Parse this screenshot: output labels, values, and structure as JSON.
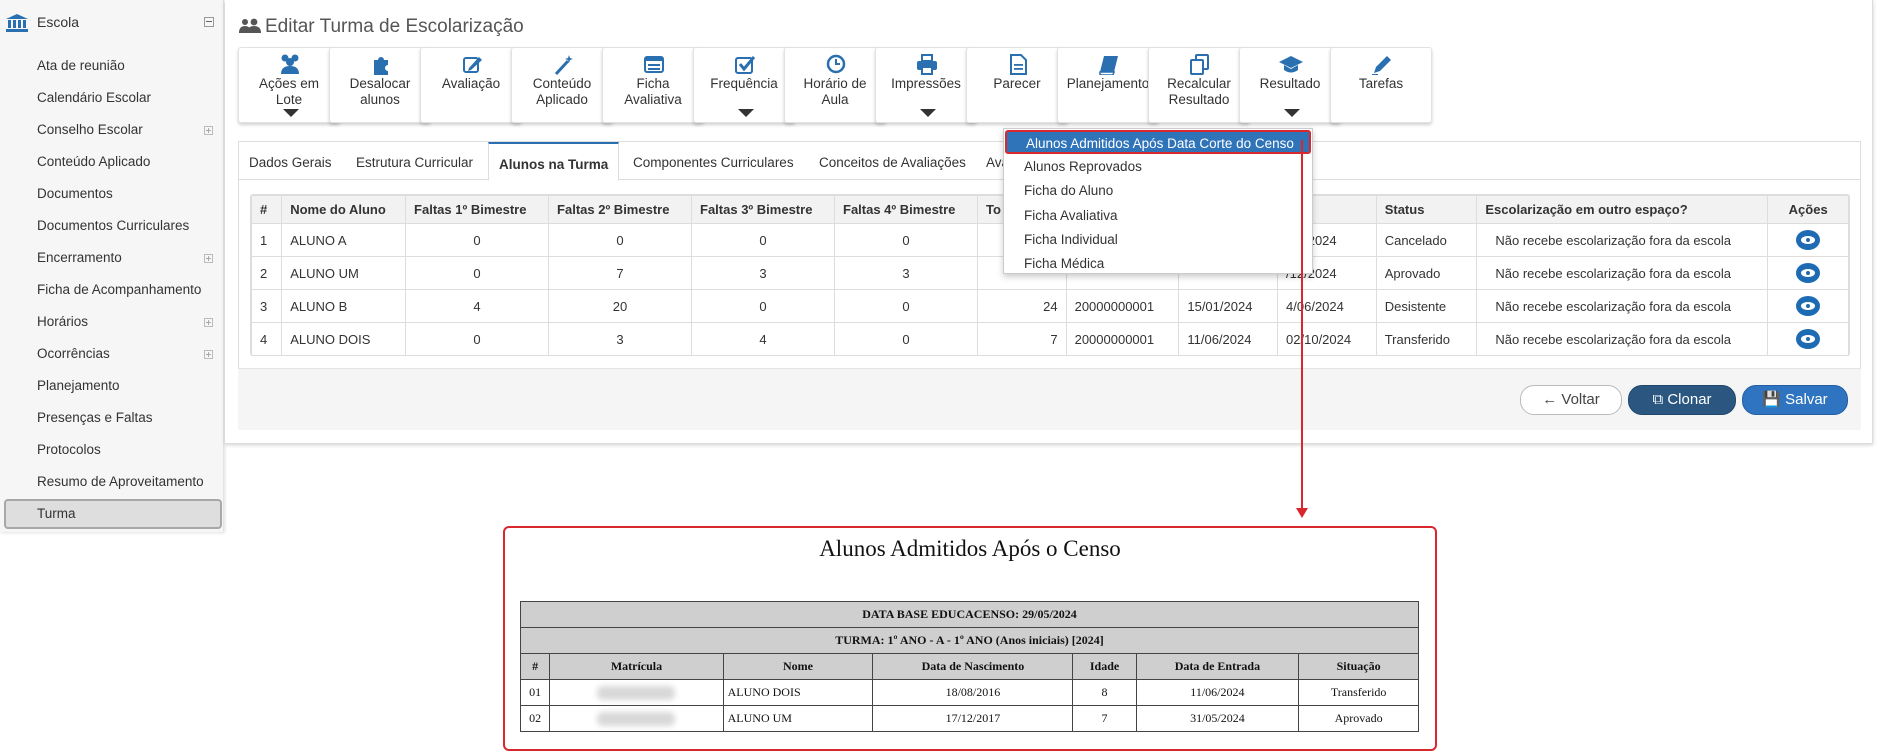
{
  "sidebar": {
    "title": "Escola",
    "items": [
      {
        "label": "Ata de reunião",
        "expandable": false
      },
      {
        "label": "Calendário Escolar",
        "expandable": false
      },
      {
        "label": "Conselho Escolar",
        "expandable": true
      },
      {
        "label": "Conteúdo Aplicado",
        "expandable": false
      },
      {
        "label": "Documentos",
        "expandable": false
      },
      {
        "label": "Documentos Curriculares",
        "expandable": false
      },
      {
        "label": "Encerramento",
        "expandable": true
      },
      {
        "label": "Ficha de Acompanhamento",
        "expandable": false
      },
      {
        "label": "Horários",
        "expandable": true
      },
      {
        "label": "Ocorrências",
        "expandable": true
      },
      {
        "label": "Planejamento",
        "expandable": false
      },
      {
        "label": "Presenças e Faltas",
        "expandable": false
      },
      {
        "label": "Protocolos",
        "expandable": false
      },
      {
        "label": "Resumo de Aproveitamento",
        "expandable": false
      },
      {
        "label": "Turma",
        "expandable": false,
        "active": true
      }
    ]
  },
  "page": {
    "title": "Editar Turma de Escolarização"
  },
  "toolbar": [
    {
      "l1": "Ações em",
      "l2": "Lote",
      "icon": "users-icon",
      "caret": true
    },
    {
      "l1": "Desalocar",
      "l2": "alunos",
      "icon": "puzzle-icon",
      "caret": false
    },
    {
      "l1": "Avaliação",
      "l2": "",
      "icon": "edit-icon",
      "caret": false
    },
    {
      "l1": "Conteúdo",
      "l2": "Aplicado",
      "icon": "magic-wand-icon",
      "caret": false
    },
    {
      "l1": "Ficha",
      "l2": "Avaliativa",
      "icon": "list-icon",
      "caret": false
    },
    {
      "l1": "Frequência",
      "l2": "",
      "icon": "check-icon",
      "caret": true
    },
    {
      "l1": "Horário de",
      "l2": "Aula",
      "icon": "clock-icon",
      "caret": false
    },
    {
      "l1": "Impressões",
      "l2": "",
      "icon": "print-icon",
      "caret": true
    },
    {
      "l1": "Parecer",
      "l2": "",
      "icon": "document-icon",
      "caret": false
    },
    {
      "l1": "Planejamento",
      "l2": "",
      "icon": "book-icon",
      "caret": false
    },
    {
      "l1": "Recalcular",
      "l2": "Resultado",
      "icon": "copy-icon",
      "caret": false
    },
    {
      "l1": "Resultado",
      "l2": "",
      "icon": "graduation-cap-icon",
      "caret": true
    },
    {
      "l1": "Tarefas",
      "l2": "",
      "icon": "pencil-icon",
      "caret": false
    }
  ],
  "tabs": [
    "Dados Gerais",
    "Estrutura Curricular",
    "Alunos na Turma",
    "Componentes Curriculares",
    "Conceitos de Avaliações",
    "Ava"
  ],
  "students_table": {
    "headers": [
      "#",
      "Nome do Aluno",
      "Faltas 1º Bimestre",
      "Faltas 2º Bimestre",
      "Faltas 3º Bimestre",
      "Faltas 4º Bimestre",
      "To",
      "",
      "",
      "ída",
      "Status",
      "Escolarização em outro espaço?",
      "Ações"
    ],
    "rows": [
      [
        "1",
        "ALUNO A",
        "0",
        "0",
        "0",
        "0",
        "",
        "",
        "",
        "/01/2024",
        "Cancelado",
        "Não recebe escolarização fora da escola"
      ],
      [
        "2",
        "ALUNO UM",
        "0",
        "7",
        "3",
        "3",
        "",
        "",
        "",
        "/12/2024",
        "Aprovado",
        "Não recebe escolarização fora da escola"
      ],
      [
        "3",
        "ALUNO B",
        "4",
        "20",
        "0",
        "0",
        "24",
        "20000000001",
        "15/01/2024",
        "4/06/2024",
        "Desistente",
        "Não recebe escolarização fora da escola"
      ],
      [
        "4",
        "ALUNO DOIS",
        "0",
        "3",
        "4",
        "0",
        "7",
        "20000000001",
        "11/06/2024",
        "02/10/2024",
        "Transferido",
        "Não recebe escolarização fora da escola"
      ]
    ]
  },
  "buttons": {
    "voltar": "Voltar",
    "clonar": "Clonar",
    "salvar": "Salvar"
  },
  "dropdown": {
    "items": [
      "Alunos Admitidos Após Data Corte do Censo",
      "Alunos Reprovados",
      "Ficha do Aluno",
      "Ficha Avaliativa",
      "Ficha Individual",
      "Ficha Médica"
    ]
  },
  "report": {
    "title": "Alunos Admitidos Após o Censo",
    "base_line": "DATA BASE EDUCACENSO: 29/05/2024",
    "turma_line": "TURMA: 1º ANO - A - 1º ANO (Anos iniciais) [2024]",
    "headers": [
      "#",
      "Matrícula",
      "Nome",
      "Data de Nascimento",
      "Idade",
      "Data de Entrada",
      "Situação"
    ],
    "rows": [
      [
        "01",
        "",
        "ALUNO DOIS",
        "18/08/2016",
        "8",
        "11/06/2024",
        "Transferido"
      ],
      [
        "02",
        "",
        "ALUNO UM",
        "17/12/2017",
        "7",
        "31/05/2024",
        "Aprovado"
      ]
    ]
  },
  "colors": {
    "accent": "#2f73b9",
    "highlight_border": "#d9272e",
    "clonar": "#2a5680",
    "salvar": "#2e74c0"
  }
}
